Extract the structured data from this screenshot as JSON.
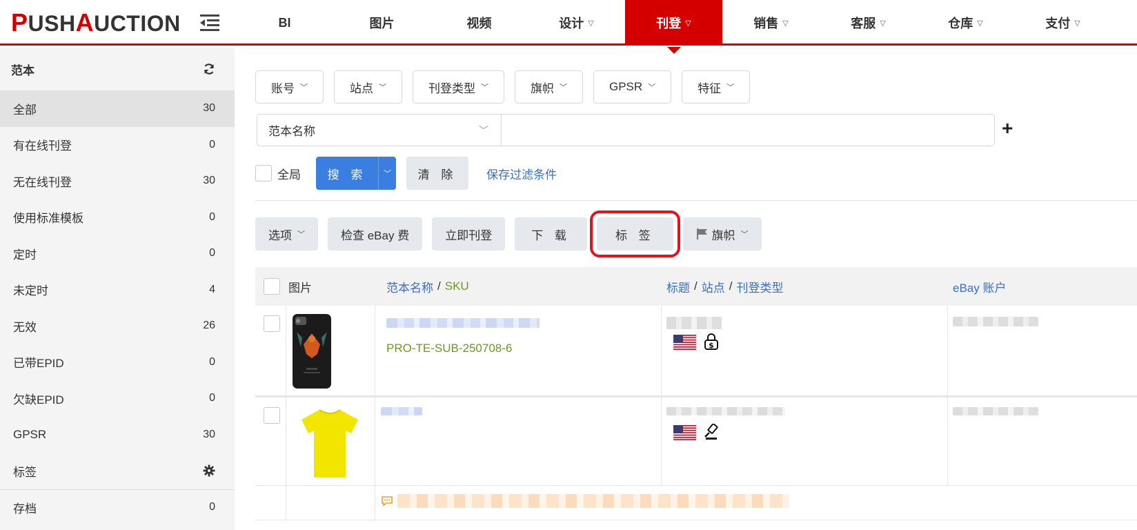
{
  "brand": {
    "logo_p": "P",
    "logo_ush": "USH",
    "logo_a": "A",
    "logo_rest": "UCTION"
  },
  "nav": {
    "items": [
      {
        "label": "BI",
        "dropdown": false
      },
      {
        "label": "图片",
        "dropdown": false
      },
      {
        "label": "视频",
        "dropdown": false
      },
      {
        "label": "设计",
        "dropdown": true
      },
      {
        "label": "刊登",
        "dropdown": true,
        "active": true
      },
      {
        "label": "销售",
        "dropdown": true
      },
      {
        "label": "客服",
        "dropdown": true
      },
      {
        "label": "仓库",
        "dropdown": true
      },
      {
        "label": "支付",
        "dropdown": true
      }
    ]
  },
  "sidebar": {
    "title": "范本",
    "items": [
      {
        "label": "全部",
        "count": "30"
      },
      {
        "label": "有在线刊登",
        "count": "0"
      },
      {
        "label": "无在线刊登",
        "count": "30"
      },
      {
        "label": "使用标准模板",
        "count": "0"
      },
      {
        "label": "定时",
        "count": "0"
      },
      {
        "label": "未定时",
        "count": "4"
      },
      {
        "label": "无效",
        "count": "26"
      },
      {
        "label": "已带EPID",
        "count": "0"
      },
      {
        "label": "欠缺EPID",
        "count": "0"
      },
      {
        "label": "GPSR",
        "count": "30"
      },
      {
        "label": "标签",
        "count": ""
      },
      {
        "label": "存档",
        "count": "0"
      }
    ]
  },
  "filters": [
    "账号",
    "站点",
    "刊登类型",
    "旗帜",
    "GPSR",
    "特征"
  ],
  "search": {
    "field_label": "范本名称",
    "value": "",
    "placeholder": ""
  },
  "actions": {
    "global_label": "全局",
    "search_label": "搜 索",
    "clear_label": "清 除",
    "save_filter_label": "保存过滤条件"
  },
  "toolbar": {
    "options_label": "选项",
    "check_fee_label": "检查 eBay 费",
    "list_now_label": "立即刊登",
    "download_label": "下 载",
    "tag_label": "标 签",
    "flag_label": "旗帜"
  },
  "table": {
    "headers": {
      "image": "图片",
      "name": "范本名称",
      "sku": "SKU",
      "title": "标题",
      "site": "站点",
      "listing_type": "刊登类型",
      "account": "eBay 账户"
    },
    "rows": [
      {
        "sku": "PRO-TE-SUB-250708-6",
        "image": "phone-case",
        "type_icon": "dollar-lock-icon"
      },
      {
        "sku": "",
        "image": "yellow-tshirt",
        "type_icon": "auction-gavel-icon"
      }
    ]
  },
  "colors": {
    "brand_red": "#d40000",
    "primary_blue": "#3a7fe0",
    "link_blue": "#3a6fc4",
    "sku_green": "#6b9a1a"
  }
}
